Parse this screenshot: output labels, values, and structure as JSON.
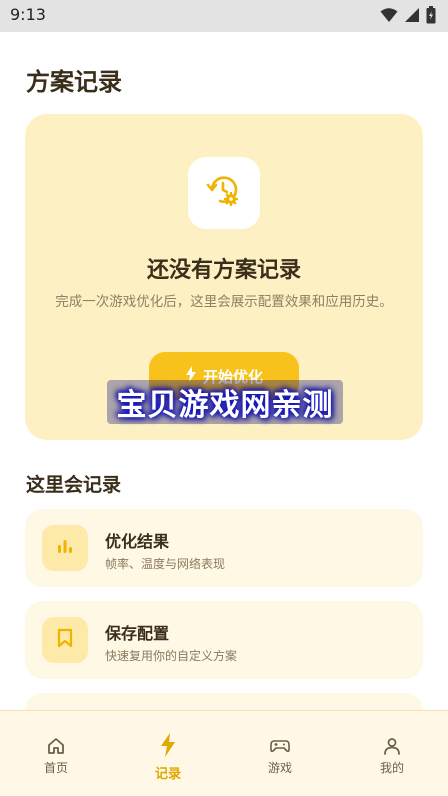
{
  "status_bar": {
    "time": "9:13"
  },
  "page": {
    "title": "方案记录"
  },
  "empty_state": {
    "icon": "clock-gear-icon",
    "title": "还没有方案记录",
    "description": "完成一次游戏优化后，这里会展示配置效果和应用历史。",
    "button_label": "开始优化",
    "button_icon": "lightning-icon"
  },
  "watermark": {
    "text": "宝贝游戏网亲测"
  },
  "section": {
    "title": "这里会记录"
  },
  "features": [
    {
      "icon": "bar-chart-icon",
      "title": "优化结果",
      "desc": "帧率、温度与网络表现"
    },
    {
      "icon": "bookmark-icon",
      "title": "保存配置",
      "desc": "快速复用你的自定义方案"
    }
  ],
  "bottom_nav": [
    {
      "icon": "home-icon",
      "label": "首页",
      "active": false
    },
    {
      "icon": "lightning-icon",
      "label": "记录",
      "active": true
    },
    {
      "icon": "gamepad-icon",
      "label": "游戏",
      "active": false
    },
    {
      "icon": "user-icon",
      "label": "我的",
      "active": false
    }
  ],
  "colors": {
    "accent": "#f7c21c",
    "card_bg": "#fdf1c4",
    "active_nav": "#e0a800"
  }
}
